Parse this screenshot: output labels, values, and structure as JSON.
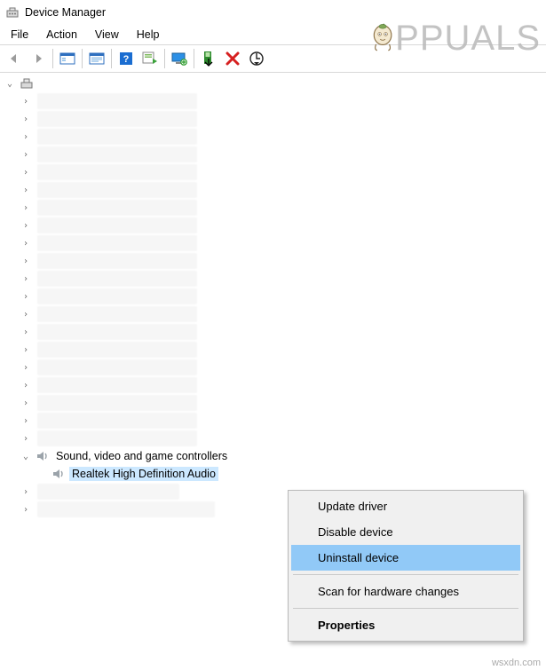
{
  "window": {
    "title": "Device Manager"
  },
  "menu": {
    "items": [
      "File",
      "Action",
      "View",
      "Help"
    ]
  },
  "toolbar": {
    "back": "back-arrow",
    "forward": "forward-arrow",
    "show_hidden": "show-hidden",
    "properties": "properties",
    "help": "help",
    "update": "update-driver",
    "monitor": "monitor",
    "install": "install",
    "uninstall": "uninstall",
    "scan": "scan-hardware"
  },
  "tree": {
    "root_icon": "computer",
    "category": {
      "label": "Sound, video and game controllers",
      "icon": "speaker",
      "child": {
        "label": "Realtek High Definition Audio",
        "icon": "speaker",
        "selected": true
      }
    }
  },
  "context_menu": {
    "items": [
      {
        "label": "Update driver",
        "highlight": false
      },
      {
        "label": "Disable device",
        "highlight": false
      },
      {
        "label": "Uninstall device",
        "highlight": true
      },
      {
        "sep": true
      },
      {
        "label": "Scan for hardware changes",
        "highlight": false
      },
      {
        "sep": true
      },
      {
        "label": "Properties",
        "highlight": false,
        "bold": true
      }
    ]
  },
  "watermark": {
    "text": "PPUALS"
  },
  "footer": {
    "credit": "wsxdn.com"
  }
}
